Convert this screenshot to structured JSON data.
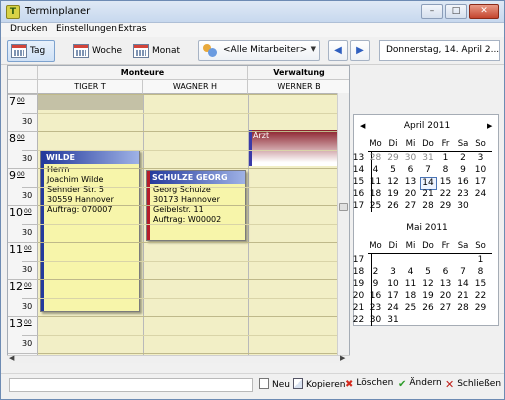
{
  "window": {
    "title": "Terminplaner",
    "icon": "terminplaner-app-icon"
  },
  "menu": [
    "Drucken",
    "Einstellungen",
    "Extras"
  ],
  "toolbar": {
    "views": [
      {
        "label": "Tag",
        "icon": "day-view-icon",
        "active": true
      },
      {
        "label": "Woche",
        "icon": "week-view-icon",
        "active": false
      },
      {
        "label": "Monat",
        "icon": "month-view-icon",
        "active": false
      }
    ],
    "employee_filter": "<Alle Mitarbeiter>",
    "current_date": "Donnerstag, 14. April 2..."
  },
  "calendar": {
    "groups": [
      {
        "label": "Monteure"
      },
      {
        "label": "Verwaltung"
      }
    ],
    "columns": [
      "TIGER T",
      "WAGNER H",
      "WERNER B"
    ],
    "hours": [
      "7",
      "8",
      "9",
      "10",
      "11",
      "12",
      "13",
      "14"
    ],
    "hour_superscript": "00",
    "half_label": "30",
    "appointments": [
      {
        "title": "WILDE",
        "lines": [
          "Herrn",
          "Joachim Wilde",
          "Sehnder Str. 5",
          "30559 Hannover",
          "Auftrag: 070007"
        ],
        "title_color": "#243a9c"
      },
      {
        "title": "SCHULZE GEORG",
        "lines": [
          "Georg Schulze",
          "30173 Hannover",
          "Geibelstr. 11",
          "Auftrag: W00002"
        ],
        "title_color": "#243a9c"
      },
      {
        "title": "Arzt",
        "lines": [],
        "title_color": "#8a1f2a"
      }
    ]
  },
  "mini_calendar": {
    "weekdays": [
      "Mo",
      "Di",
      "Mi",
      "Do",
      "Fr",
      "Sa",
      "So"
    ],
    "months": [
      {
        "title": "April 2011",
        "weeks": [
          {
            "wk": "13",
            "days": [
              "28",
              "29",
              "30",
              "31",
              "1",
              "2",
              "3"
            ],
            "dim": [
              true,
              true,
              true,
              true,
              false,
              false,
              false
            ]
          },
          {
            "wk": "14",
            "days": [
              "4",
              "5",
              "6",
              "7",
              "8",
              "9",
              "10"
            ]
          },
          {
            "wk": "15",
            "days": [
              "11",
              "12",
              "13",
              "14",
              "15",
              "16",
              "17"
            ],
            "today": 3
          },
          {
            "wk": "16",
            "days": [
              "18",
              "19",
              "20",
              "21",
              "22",
              "23",
              "24"
            ]
          },
          {
            "wk": "17",
            "days": [
              "25",
              "26",
              "27",
              "28",
              "29",
              "30",
              ""
            ]
          }
        ]
      },
      {
        "title": "Mai 2011",
        "weeks": [
          {
            "wk": "17",
            "days": [
              "",
              "",
              "",
              "",
              "",
              "",
              "1"
            ]
          },
          {
            "wk": "18",
            "days": [
              "2",
              "3",
              "4",
              "5",
              "6",
              "7",
              "8"
            ]
          },
          {
            "wk": "19",
            "days": [
              "9",
              "10",
              "11",
              "12",
              "13",
              "14",
              "15"
            ]
          },
          {
            "wk": "20",
            "days": [
              "16",
              "17",
              "18",
              "19",
              "20",
              "21",
              "22"
            ]
          },
          {
            "wk": "21",
            "days": [
              "23",
              "24",
              "25",
              "26",
              "27",
              "28",
              "29"
            ]
          },
          {
            "wk": "22",
            "days": [
              "30",
              "31",
              "",
              "",
              "",
              "",
              ""
            ]
          }
        ]
      }
    ]
  },
  "statusbar": {
    "buttons": [
      {
        "label": "Neu",
        "icon": "new-document-icon"
      },
      {
        "label": "Kopieren",
        "icon": "copy-icon"
      },
      {
        "label": "Löschen",
        "icon": "delete-icon"
      },
      {
        "label": "Ändern",
        "icon": "checkmark-icon"
      },
      {
        "label": "Schließen",
        "icon": "close-x-icon"
      }
    ]
  }
}
